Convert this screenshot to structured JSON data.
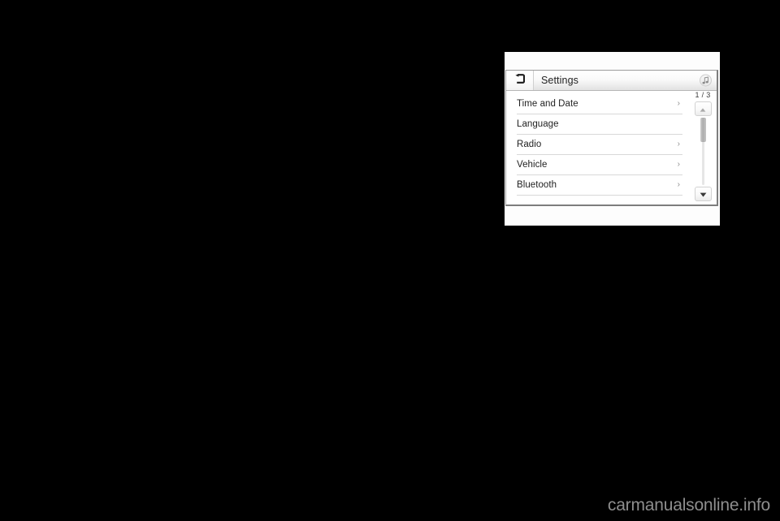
{
  "page": {
    "background_color": "#000000",
    "watermark": "carmanualsonline.info"
  },
  "figure": {
    "card_background": "#fdfdfd"
  },
  "screen": {
    "header": {
      "back_icon": "back-arrow-icon",
      "title": "Settings",
      "right_icon": "music-note-icon"
    },
    "list": {
      "rows": [
        {
          "label": "Time and Date",
          "chevron": "›",
          "has_chevron": true
        },
        {
          "label": "Language",
          "chevron": "",
          "has_chevron": false
        },
        {
          "label": "Radio",
          "chevron": "›",
          "has_chevron": true
        },
        {
          "label": "Vehicle",
          "chevron": "›",
          "has_chevron": true
        },
        {
          "label": "Bluetooth",
          "chevron": "›",
          "has_chevron": true
        }
      ]
    },
    "scroll": {
      "page_indicator": "1 / 3",
      "up_button_icon": "triangle-up-icon",
      "down_button_icon": "triangle-down-icon",
      "thumb_position_percent": 8,
      "thumb_size_percent": 28
    }
  },
  "colors": {
    "screen_border": "#9c9c9c",
    "header_bottom_border": "#b6b6b6",
    "row_separator": "#d8d8d8",
    "text_primary": "#222222",
    "chevron": "#8e8e8e",
    "scroll_thumb": "#adadad",
    "watermark": "#8e8e8e"
  }
}
